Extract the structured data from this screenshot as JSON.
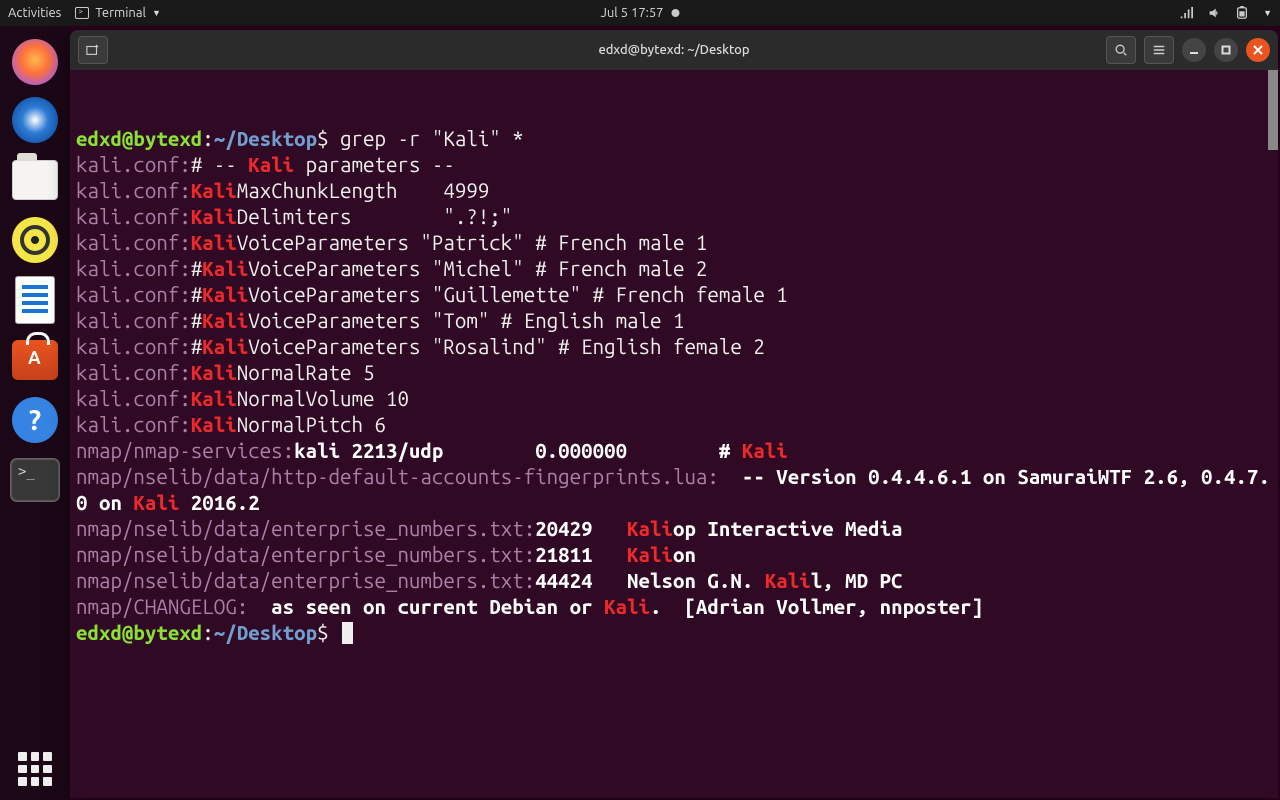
{
  "topbar": {
    "activities": "Activities",
    "app_name": "Terminal",
    "datetime": "Jul 5  17:57"
  },
  "dock": {
    "items": [
      "firefox",
      "thunderbird",
      "files",
      "rhythmbox",
      "writer",
      "software",
      "help",
      "terminal"
    ]
  },
  "window": {
    "title": "edxd@bytexd: ~/Desktop"
  },
  "prompt": {
    "user_host": "edxd@bytexd",
    "sep": ":",
    "path": "~/Desktop",
    "sym": "$ "
  },
  "command": "grep -r \"Kali\" *",
  "output": [
    {
      "file": "kali.conf:",
      "segs": [
        {
          "c": "white",
          "t": "# -- "
        },
        {
          "c": "red",
          "t": "Kali"
        },
        {
          "c": "white",
          "t": " parameters --"
        }
      ]
    },
    {
      "file": "kali.conf:",
      "segs": [
        {
          "c": "red",
          "t": "Kali"
        },
        {
          "c": "white",
          "t": "MaxChunkLength    4999"
        }
      ]
    },
    {
      "file": "kali.conf:",
      "segs": [
        {
          "c": "red",
          "t": "Kali"
        },
        {
          "c": "white",
          "t": "Delimiters        \".?!;\""
        }
      ]
    },
    {
      "file": "kali.conf:",
      "segs": [
        {
          "c": "red",
          "t": "Kali"
        },
        {
          "c": "white",
          "t": "VoiceParameters \"Patrick\" # French male 1"
        }
      ]
    },
    {
      "file": "kali.conf:",
      "segs": [
        {
          "c": "white",
          "t": "#"
        },
        {
          "c": "red",
          "t": "Kali"
        },
        {
          "c": "white",
          "t": "VoiceParameters \"Michel\" # French male 2"
        }
      ]
    },
    {
      "file": "kali.conf:",
      "segs": [
        {
          "c": "white",
          "t": "#"
        },
        {
          "c": "red",
          "t": "Kali"
        },
        {
          "c": "white",
          "t": "VoiceParameters \"Guillemette\" # French female 1"
        }
      ]
    },
    {
      "file": "kali.conf:",
      "segs": [
        {
          "c": "white",
          "t": "#"
        },
        {
          "c": "red",
          "t": "Kali"
        },
        {
          "c": "white",
          "t": "VoiceParameters \"Tom\" # English male 1"
        }
      ]
    },
    {
      "file": "kali.conf:",
      "segs": [
        {
          "c": "white",
          "t": "#"
        },
        {
          "c": "red",
          "t": "Kali"
        },
        {
          "c": "white",
          "t": "VoiceParameters \"Rosalind\" # English female 2"
        }
      ]
    },
    {
      "file": "kali.conf:",
      "segs": [
        {
          "c": "red",
          "t": "Kali"
        },
        {
          "c": "white",
          "t": "NormalRate 5"
        }
      ]
    },
    {
      "file": "kali.conf:",
      "segs": [
        {
          "c": "red",
          "t": "Kali"
        },
        {
          "c": "white",
          "t": "NormalVolume 10"
        }
      ]
    },
    {
      "file": "kali.conf:",
      "segs": [
        {
          "c": "red",
          "t": "Kali"
        },
        {
          "c": "white",
          "t": "NormalPitch 6"
        }
      ]
    },
    {
      "file": "nmap/nmap-services:",
      "segs": [
        {
          "c": "whbold",
          "t": "kali 2213/udp        0.000000        # "
        },
        {
          "c": "red",
          "t": "Kali"
        }
      ]
    },
    {
      "file": "nmap/nselib/data/http-default-accounts-fingerprints.lua:",
      "segs": [
        {
          "c": "whbold",
          "t": "  -- Version 0.4.4.6.1 on SamuraiWTF 2.6, 0.4.7.0 on "
        },
        {
          "c": "red",
          "t": "Kali"
        },
        {
          "c": "whbold",
          "t": " 2016.2"
        }
      ]
    },
    {
      "file": "nmap/nselib/data/enterprise_numbers.txt:",
      "segs": [
        {
          "c": "whbold",
          "t": "20429   "
        },
        {
          "c": "red",
          "t": "Kali"
        },
        {
          "c": "whbold",
          "t": "op Interactive Media"
        }
      ]
    },
    {
      "file": "nmap/nselib/data/enterprise_numbers.txt:",
      "segs": [
        {
          "c": "whbold",
          "t": "21811   "
        },
        {
          "c": "red",
          "t": "Kali"
        },
        {
          "c": "whbold",
          "t": "on"
        }
      ]
    },
    {
      "file": "nmap/nselib/data/enterprise_numbers.txt:",
      "segs": [
        {
          "c": "whbold",
          "t": "44424   Nelson G.N. "
        },
        {
          "c": "red",
          "t": "Kali"
        },
        {
          "c": "whbold",
          "t": "l, MD PC"
        }
      ]
    },
    {
      "file": "nmap/CHANGELOG:",
      "segs": [
        {
          "c": "whbold",
          "t": "  as seen on current Debian or "
        },
        {
          "c": "red",
          "t": "Kali"
        },
        {
          "c": "whbold",
          "t": ".  [Adrian Vollmer, nnposter]"
        }
      ]
    }
  ]
}
